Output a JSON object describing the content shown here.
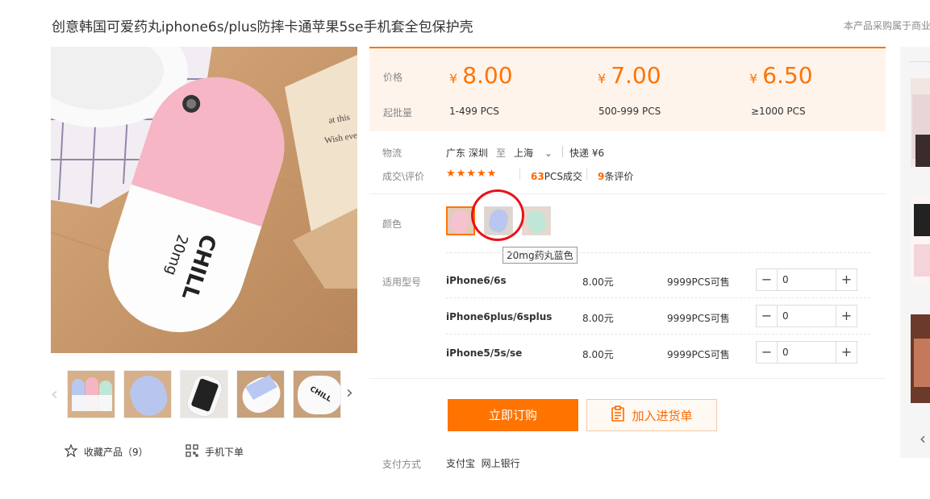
{
  "product": {
    "title": "创意韩国可爱药丸iphone6s/plus防摔卡通苹果5se手机套全包保护壳",
    "side_note": "本产品采购属于商业"
  },
  "gallery": {
    "main_image_text": "CHILL",
    "main_image_subtext": "20mg",
    "thumbnails": [
      "thumb-1",
      "thumb-2",
      "thumb-3",
      "thumb-4",
      "thumb-5"
    ]
  },
  "actions": {
    "favorite_label": "收藏产品（9）",
    "mobile_order_label": "手机下单"
  },
  "pricing": {
    "price_label": "价格",
    "moq_label": "起批量",
    "currency": "¥",
    "tiers": [
      {
        "price": "8.00",
        "qty": "1-499 PCS"
      },
      {
        "price": "7.00",
        "qty": "500-999 PCS"
      },
      {
        "price": "6.50",
        "qty": "≥1000 PCS"
      }
    ]
  },
  "logistics": {
    "label": "物流",
    "from": "广东 深圳",
    "to_word": "至",
    "to": "上海",
    "express": "快递 ¥6"
  },
  "reviews": {
    "label": "成交\\评价",
    "stars": "★★★★★",
    "deals_count": "63",
    "deals_suffix": "PCS成交",
    "review_count": "9",
    "review_suffix": "条评价"
  },
  "color": {
    "label": "颜色",
    "tooltip": "20mg药丸蓝色"
  },
  "models": {
    "label": "适用型号",
    "rows": [
      {
        "name": "iPhone6/6s",
        "price": "8.00元",
        "stock": "9999PCS可售",
        "qty": "0"
      },
      {
        "name": "iPhone6plus/6splus",
        "price": "8.00元",
        "stock": "9999PCS可售",
        "qty": "0"
      },
      {
        "name": "iPhone5/5s/se",
        "price": "8.00元",
        "stock": "9999PCS可售",
        "qty": "0"
      }
    ]
  },
  "buttons": {
    "buy_now": "立即订购",
    "add_to_list": "加入进货单"
  },
  "payment": {
    "label": "支付方式",
    "methods": "支付宝  网上银行"
  },
  "colors": {
    "accent": "#ff7300",
    "price_bg": "#fff4ec",
    "annotation_red": "#e8121b"
  }
}
